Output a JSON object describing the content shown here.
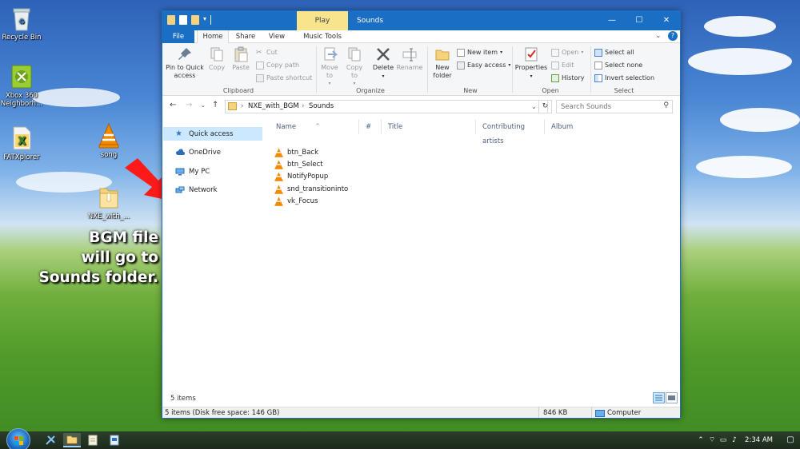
{
  "desktop": {
    "icons": [
      {
        "label": "Recycle Bin"
      },
      {
        "label": "Xbox 360 Neighborh..."
      },
      {
        "label": "FATXplorer"
      },
      {
        "label": "song"
      },
      {
        "label": "NXE_with_..."
      }
    ],
    "annotation": [
      "BGM file",
      "will go to",
      "Sounds folder."
    ]
  },
  "window": {
    "title": "Sounds",
    "contextual_tab": "Play",
    "controls": {
      "minimize": "—",
      "maximize": "☐",
      "close": "✕"
    },
    "tabs": [
      {
        "label": "File"
      },
      {
        "label": "Home"
      },
      {
        "label": "Share"
      },
      {
        "label": "View"
      },
      {
        "label": "Music Tools"
      }
    ],
    "ribbon": {
      "clipboard": {
        "pin": "Pin to Quick access",
        "copy": "Copy",
        "paste": "Paste",
        "cut": "Cut",
        "copy_path": "Copy path",
        "paste_shortcut": "Paste shortcut",
        "label": "Clipboard"
      },
      "organize": {
        "move_to": "Move to",
        "copy_to": "Copy to",
        "delete": "Delete",
        "rename": "Rename",
        "label": "Organize"
      },
      "new": {
        "new_folder": "New folder",
        "new_item": "New item",
        "easy_access": "Easy access",
        "label": "New"
      },
      "open": {
        "properties": "Properties",
        "open": "Open",
        "edit": "Edit",
        "history": "History",
        "label": "Open"
      },
      "select": {
        "select_all": "Select all",
        "select_none": "Select none",
        "invert_selection": "Invert selection",
        "label": "Select"
      }
    },
    "address": {
      "segments": [
        "NXE_with_BGM",
        "Sounds"
      ],
      "search_placeholder": "Search Sounds"
    },
    "nav": [
      {
        "label": "Quick access"
      },
      {
        "label": "OneDrive"
      },
      {
        "label": "My PC"
      },
      {
        "label": "Network"
      }
    ],
    "columns": [
      "Name",
      "#",
      "Title",
      "Contributing artists",
      "Album"
    ],
    "files": [
      "btn_Back",
      "btn_Select",
      "NotifyPopup",
      "snd_transitioninto",
      "vk_Focus"
    ],
    "status": {
      "item_count": "5 items",
      "details": "5 items (Disk free space: 146 GB)",
      "size": "846 KB",
      "location": "Computer"
    }
  },
  "taskbar": {
    "time": "2:34 AM"
  },
  "colors": {
    "accent": "#1a6fc4",
    "contextual_tab": "#f7e48d",
    "selection": "#cce8ff",
    "vlc_orange": "#f28a00"
  }
}
